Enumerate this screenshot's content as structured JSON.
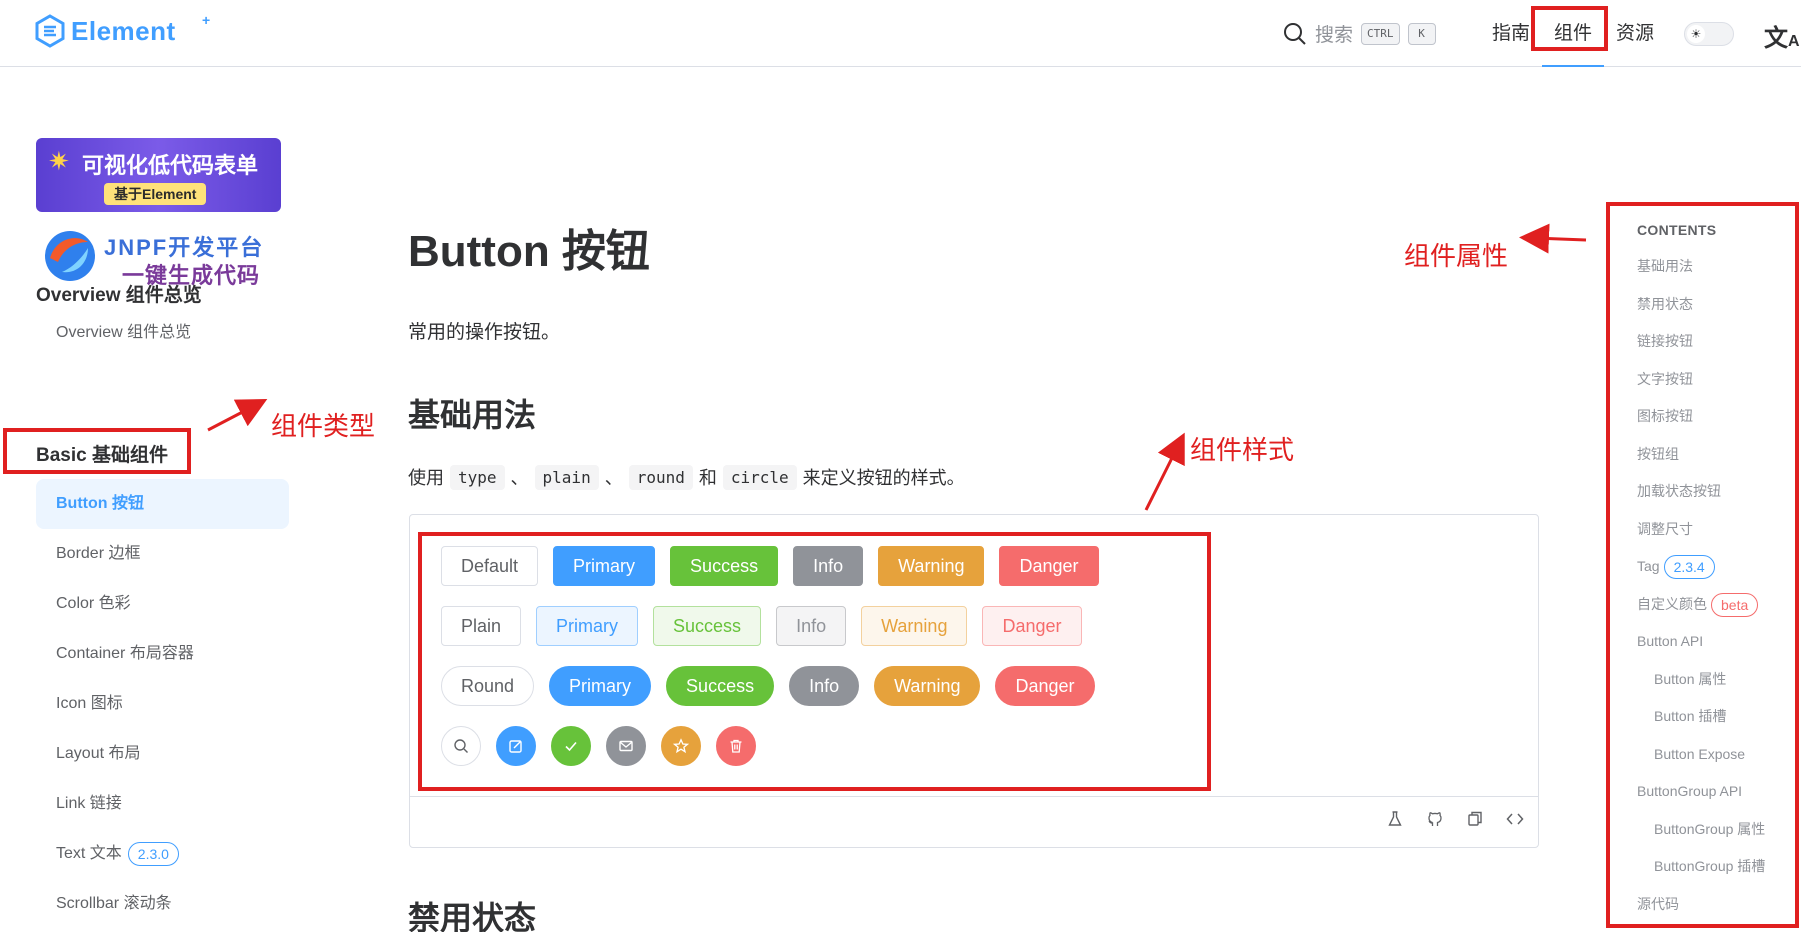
{
  "header": {
    "logo_text": "Element",
    "logo_sup": "+",
    "search_label": "搜索",
    "search_kbd": [
      "CTRL",
      "K"
    ],
    "nav": [
      "指南",
      "组件",
      "资源"
    ],
    "active_nav": "组件"
  },
  "sidebar": {
    "banner1_title": "可视化低代码表单",
    "banner1_sub": "基于Element",
    "banner2_brand": "JNPF",
    "banner2_brand_suffix": "开发平台",
    "banner2_sub": "一键生成代码",
    "group_overview": "Overview 组件总览",
    "overview_item": "Overview 组件总览",
    "group_basic": "Basic 基础组件",
    "items": [
      {
        "label": "Button 按钮",
        "active": true
      },
      {
        "label": "Border 边框"
      },
      {
        "label": "Color 色彩"
      },
      {
        "label": "Container 布局容器"
      },
      {
        "label": "Icon 图标"
      },
      {
        "label": "Layout 布局"
      },
      {
        "label": "Link 链接"
      },
      {
        "label": "Text 文本",
        "badge": "2.3.0"
      },
      {
        "label": "Scrollbar 滚动条"
      }
    ]
  },
  "annotations": {
    "component_type": "组件类型",
    "component_style": "组件样式",
    "component_props": "组件属性"
  },
  "main": {
    "title": "Button 按钮",
    "description": "常用的操作按钮。",
    "section1": "基础用法",
    "usage": {
      "prefix": "使用",
      "codes": [
        "type",
        "plain",
        "round",
        "circle"
      ],
      "sep1": "、",
      "sep2": "、",
      "and": "和",
      "suffix": "来定义按钮的样式。"
    },
    "rows": {
      "default": [
        "Default",
        "Primary",
        "Success",
        "Info",
        "Warning",
        "Danger"
      ],
      "plain": [
        "Plain",
        "Primary",
        "Success",
        "Info",
        "Warning",
        "Danger"
      ],
      "round": [
        "Round",
        "Primary",
        "Success",
        "Info",
        "Warning",
        "Danger"
      ]
    },
    "circle_icons": [
      "search-icon",
      "edit-icon",
      "check-icon",
      "message-icon",
      "star-icon",
      "delete-icon"
    ],
    "section2": "禁用状态",
    "tools": [
      "playground-icon",
      "github-icon",
      "copy-icon",
      "code-icon"
    ]
  },
  "toc": {
    "heading": "CONTENTS",
    "items": [
      {
        "label": "基础用法"
      },
      {
        "label": "禁用状态"
      },
      {
        "label": "链接按钮"
      },
      {
        "label": "文字按钮"
      },
      {
        "label": "图标按钮"
      },
      {
        "label": "按钮组"
      },
      {
        "label": "加载状态按钮"
      },
      {
        "label": "调整尺寸"
      },
      {
        "label": "Tag",
        "badge": "2.3.4",
        "badge_color": "blue"
      },
      {
        "label": "自定义颜色",
        "badge": "beta",
        "badge_color": "red"
      },
      {
        "label": "Button API"
      },
      {
        "label": "Button 属性",
        "sub": true
      },
      {
        "label": "Button 插槽",
        "sub": true
      },
      {
        "label": "Button Expose",
        "sub": true
      },
      {
        "label": "ButtonGroup API"
      },
      {
        "label": "ButtonGroup 属性",
        "sub": true
      },
      {
        "label": "ButtonGroup 插槽",
        "sub": true
      },
      {
        "label": "源代码"
      }
    ]
  },
  "colors": {
    "primary": "#409eff",
    "success": "#67c23a",
    "info": "#909399",
    "warning": "#e6a23c",
    "danger": "#f56c6c",
    "annotation": "#e02020"
  }
}
